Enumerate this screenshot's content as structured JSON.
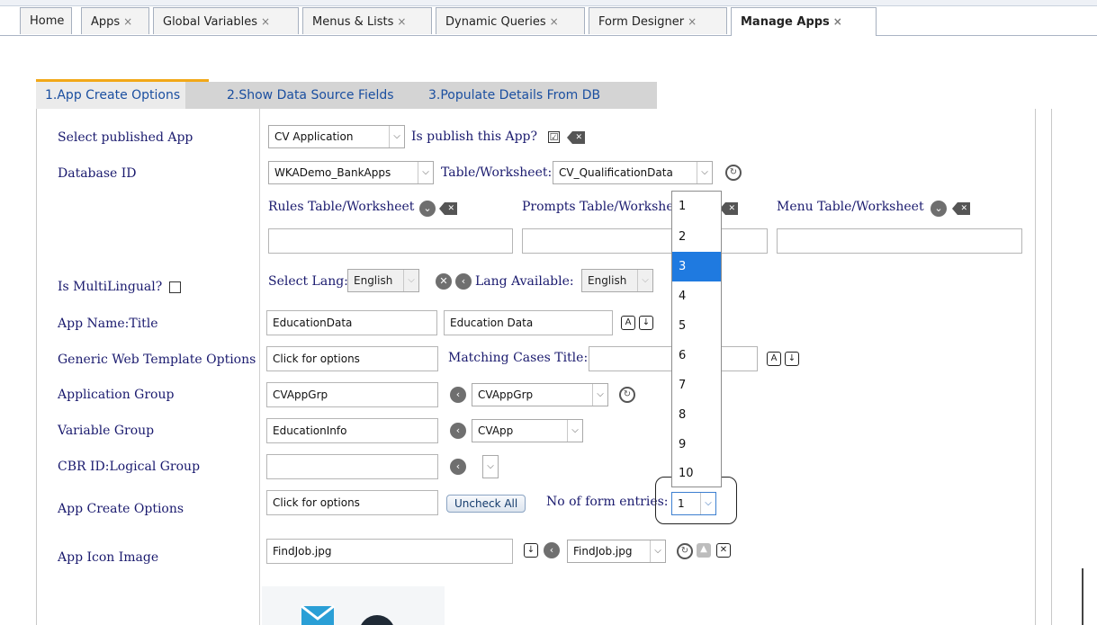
{
  "tabs": [
    {
      "label": "Home",
      "close": ""
    },
    {
      "label": "Apps",
      "close": "×"
    },
    {
      "label": "Global Variables",
      "close": "×"
    },
    {
      "label": "Menus & Lists",
      "close": "×"
    },
    {
      "label": "Dynamic Queries",
      "close": "×"
    },
    {
      "label": "Form Designer",
      "close": "×"
    },
    {
      "label": "Manage Apps",
      "close": "×"
    }
  ],
  "wizard": {
    "step1": "1.App Create Options",
    "step2": "2.Show Data Source Fields",
    "step3": "3.Populate Details From DB"
  },
  "form": {
    "published_app": {
      "label": "Select published App",
      "value": "CV Application",
      "publish_label": "Is publish this App?",
      "publish_checked": "☑"
    },
    "database": {
      "label": "Database ID",
      "value": "WKADemo_BankApps",
      "table_label": "Table/Worksheet:",
      "table_value": "CV_QualificationData"
    },
    "rules_label": "Rules Table/Worksheet",
    "prompts_label": "Prompts Table/Workshe",
    "menu_label": "Menu Table/Worksheet",
    "multilingual": {
      "label": "Is MultiLingual?",
      "select_lang_label": "Select Lang:",
      "select_lang_value": "English",
      "lang_available_label": "Lang Available:",
      "lang_available_value": "English"
    },
    "app_name": {
      "label": "App Name:Title",
      "name": "EducationData",
      "title": "Education Data"
    },
    "web_template": {
      "label": "Generic Web Template Options",
      "value": "Click for options",
      "matching_label": "Matching Cases Title:"
    },
    "app_group": {
      "label": "Application Group",
      "value": "CVAppGrp",
      "select": "CVAppGrp"
    },
    "var_group": {
      "label": "Variable Group",
      "value": "EducationInfo",
      "select": "CVApp"
    },
    "cbr": {
      "label": "CBR ID:Logical Group"
    },
    "create_options": {
      "label": "App Create Options",
      "value": "Click for options",
      "uncheck": "Uncheck All",
      "entries_label": "No of form entries:",
      "entries_value": "1"
    },
    "icon": {
      "label": "App Icon Image",
      "value": "FindJob.jpg",
      "select": "FindJob.jpg"
    }
  },
  "dropdown_options": [
    "1",
    "2",
    "3",
    "4",
    "5",
    "6",
    "7",
    "8",
    "9",
    "10"
  ],
  "dropdown_selected": "3",
  "colors": {
    "accent": "#f2a818",
    "link": "#1b4fa0",
    "label": "#1a1a6e",
    "selection": "#1f7ae0"
  }
}
